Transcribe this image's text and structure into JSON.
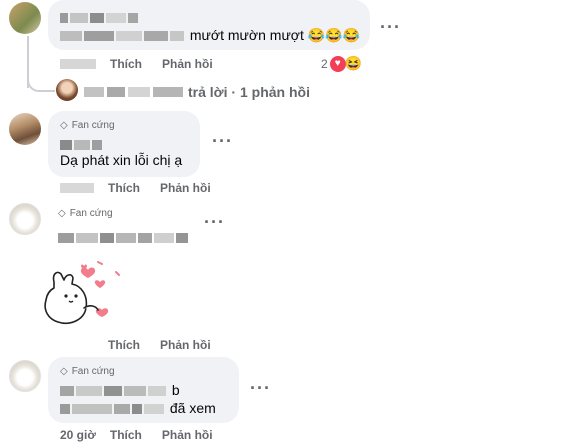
{
  "thread_top": {
    "text_tail": "mướt mườn mượt",
    "like_label": "Thích",
    "reply_label": "Phản hồi",
    "reaction_count": "2",
    "reply_link": "trả lời · 1 phản hồi",
    "more": "···"
  },
  "comment2": {
    "badge": "Fan cứng",
    "text": "Dạ phát xin lỗi chị ạ",
    "like_label": "Thích",
    "reply_label": "Phản hồi",
    "more": "···"
  },
  "comment3": {
    "badge": "Fan cứng",
    "like_label": "Thích",
    "reply_label": "Phản hồi",
    "more": "···"
  },
  "comment4": {
    "badge": "Fan cứng",
    "line1_tail": "b",
    "line2_tail": "đã xem",
    "time": "20 giờ",
    "like_label": "Thích",
    "reply_label": "Phản hồi",
    "more": "···"
  },
  "colors": {
    "bubble": "#f0f2f5",
    "secondary_text": "#65676b",
    "heart": "#f33e58",
    "haha": "#f7b125"
  }
}
